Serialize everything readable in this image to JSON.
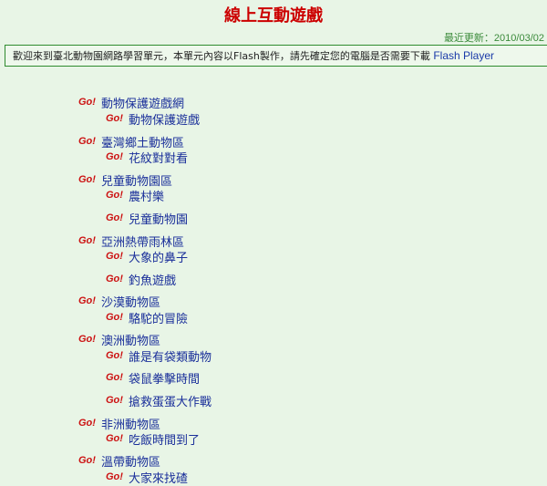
{
  "page": {
    "title": "線上互動遊戲",
    "updated": "最近更新：2010/03/02",
    "notice_text": "歡迎來到臺北動物園網路學習單元，本單元內容以Flash製作，請先確定您的電腦是否需要下載",
    "notice_link": "Flash Player",
    "go_label": "Go!"
  },
  "items": [
    {
      "level": 1,
      "label": "動物保護遊戲網"
    },
    {
      "level": 2,
      "label": "動物保護遊戲"
    },
    {
      "level": 1,
      "label": "臺灣鄉土動物區"
    },
    {
      "level": 2,
      "label": "花紋對對看"
    },
    {
      "level": 1,
      "label": "兒童動物園區"
    },
    {
      "level": 2,
      "label": "農村樂"
    },
    {
      "level": 2,
      "label": "兒童動物園"
    },
    {
      "level": 1,
      "label": "亞洲熱帶雨林區"
    },
    {
      "level": 2,
      "label": "大象的鼻子"
    },
    {
      "level": 2,
      "label": "釣魚遊戲"
    },
    {
      "level": 1,
      "label": "沙漠動物區"
    },
    {
      "level": 2,
      "label": "駱駝的冒險"
    },
    {
      "level": 1,
      "label": "澳洲動物區"
    },
    {
      "level": 2,
      "label": "誰是有袋類動物"
    },
    {
      "level": 2,
      "label": "袋鼠拳擊時間"
    },
    {
      "level": 2,
      "label": "搶救蛋蛋大作戰"
    },
    {
      "level": 1,
      "label": "非洲動物區"
    },
    {
      "level": 2,
      "label": "吃飯時間到了"
    },
    {
      "level": 1,
      "label": "溫帶動物區"
    },
    {
      "level": 2,
      "label": "大家來找碴"
    }
  ]
}
